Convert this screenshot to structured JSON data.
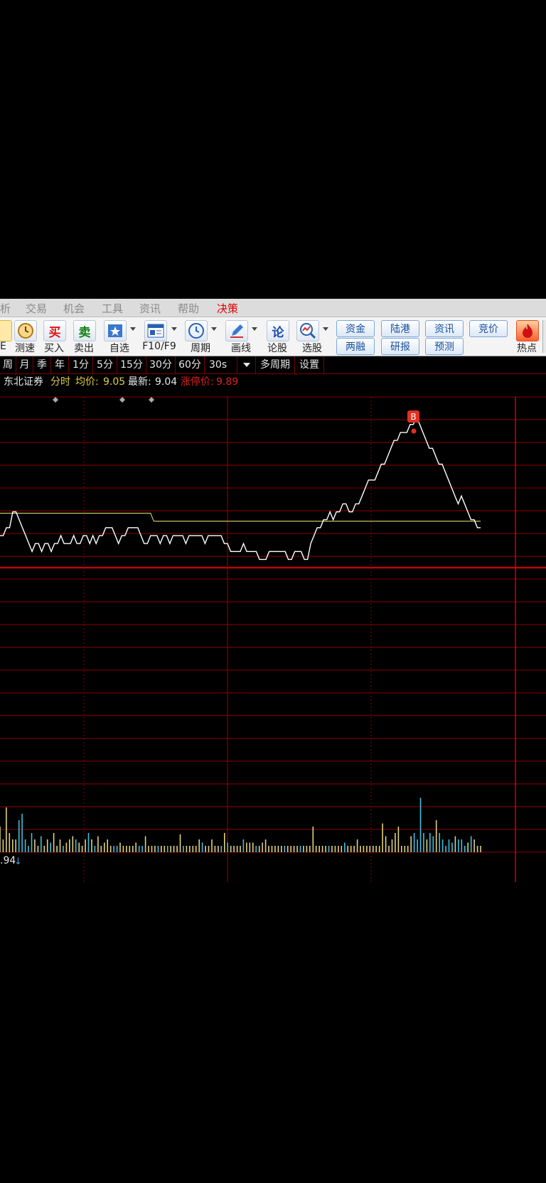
{
  "menu": {
    "items": [
      "析",
      "交易",
      "机会",
      "工具",
      "资讯",
      "帮助",
      "决策"
    ],
    "active": "决策"
  },
  "toolbar": {
    "buttons": [
      {
        "label": "E",
        "icon": "partial-icon"
      },
      {
        "label": "测速",
        "icon": "clock-icon"
      },
      {
        "label": "买入",
        "icon": "buy-icon",
        "glyph": "买"
      },
      {
        "label": "卖出",
        "icon": "sell-icon",
        "glyph": "卖"
      },
      {
        "label": "自选",
        "icon": "star-icon"
      },
      {
        "label": "F10/F9",
        "icon": "f10-icon"
      },
      {
        "label": "周期",
        "icon": "period-clock-icon"
      },
      {
        "label": "画线",
        "icon": "pencil-icon"
      },
      {
        "label": "论股",
        "icon": "discuss-icon",
        "glyph": "论"
      },
      {
        "label": "选股",
        "icon": "magnifier-chart-icon"
      },
      {
        "label": "热点",
        "icon": "hot-icon"
      }
    ],
    "pills": [
      "资金",
      "陆港",
      "资讯",
      "竞价",
      "两融",
      "研报",
      "预测"
    ]
  },
  "periods": [
    "周",
    "月",
    "季",
    "年",
    "1分",
    "5分",
    "15分",
    "30分",
    "60分",
    "30s",
    "多周期",
    "设置"
  ],
  "info": {
    "name": "东北证券",
    "mode": "分时",
    "avg_label": "均价:",
    "avg_value": "9.05",
    "last_label": "最新:",
    "last_value": "9.04",
    "limit_label": "涨停价:",
    "limit_value": "9.89"
  },
  "footer_value": ".94",
  "marker_label": "B",
  "colors": {
    "grid": "#8b0000",
    "price_line": "#ffffff",
    "avg_line": "#c8c060",
    "volume_up": "#e0d080",
    "volume_down": "#40c0e0",
    "marker": "#e03020",
    "limit_text": "#e02020",
    "avg_text": "#e0d040"
  },
  "chart_data": {
    "type": "line",
    "series": [
      {
        "name": "分时",
        "values": [
          9.03,
          9.03,
          9.04,
          9.04,
          9.06,
          9.06,
          9.05,
          9.04,
          9.03,
          9.02,
          9.01,
          9.02,
          9.02,
          9.01,
          9.02,
          9.02,
          9.01,
          9.02,
          9.02,
          9.03,
          9.02,
          9.02,
          9.02,
          9.03,
          9.02,
          9.02,
          9.03,
          9.03,
          9.02,
          9.03,
          9.02,
          9.03,
          9.03,
          9.04,
          9.04,
          9.04,
          9.03,
          9.02,
          9.03,
          9.03,
          9.04,
          9.04,
          9.04,
          9.04,
          9.03,
          9.02,
          9.02,
          9.03,
          9.03,
          9.03,
          9.02,
          9.03,
          9.03,
          9.02,
          9.03,
          9.03,
          9.03,
          9.03,
          9.02,
          9.03,
          9.03,
          9.03,
          9.03,
          9.03,
          9.02,
          9.03,
          9.03,
          9.03,
          9.03,
          9.03,
          9.02,
          9.02,
          9.01,
          9.01,
          9.01,
          9.01,
          9.02,
          9.01,
          9.01,
          9.01,
          9.01,
          9.0,
          9.0,
          9.0,
          9.01,
          9.01,
          9.01,
          9.01,
          9.01,
          9.01,
          9.0,
          9.0,
          9.01,
          9.01,
          9.01,
          9.0,
          9.0,
          9.02,
          9.03,
          9.04,
          9.04,
          9.05,
          9.05,
          9.06,
          9.05,
          9.06,
          9.06,
          9.07,
          9.07,
          9.06,
          9.06,
          9.07,
          9.07,
          9.08,
          9.09,
          9.1,
          9.1,
          9.1,
          9.11,
          9.12,
          9.12,
          9.13,
          9.14,
          9.15,
          9.15,
          9.16,
          9.16,
          9.16,
          9.17,
          9.17,
          9.18,
          9.17,
          9.16,
          9.15,
          9.14,
          9.14,
          9.13,
          9.12,
          9.12,
          9.11,
          9.1,
          9.09,
          9.08,
          9.07,
          9.08,
          9.07,
          9.06,
          9.05,
          9.05,
          9.04,
          9.04
        ]
      },
      {
        "name": "均价",
        "values": [
          9.06,
          9.06,
          9.06,
          9.06,
          9.06,
          9.06,
          9.06,
          9.06,
          9.06,
          9.06,
          9.06,
          9.06,
          9.06,
          9.06,
          9.06,
          9.06,
          9.06,
          9.06,
          9.06,
          9.06,
          9.06,
          9.06,
          9.06,
          9.06,
          9.06,
          9.06,
          9.06,
          9.06,
          9.06,
          9.06,
          9.06,
          9.06,
          9.06,
          9.06,
          9.06,
          9.06,
          9.06,
          9.06,
          9.06,
          9.06,
          9.06,
          9.06,
          9.06,
          9.06,
          9.06,
          9.06,
          9.06,
          9.06,
          9.05,
          9.05,
          9.05,
          9.05,
          9.05,
          9.05,
          9.05,
          9.05,
          9.05,
          9.05,
          9.05,
          9.05,
          9.05,
          9.05,
          9.05,
          9.05,
          9.05,
          9.05,
          9.05,
          9.05,
          9.05,
          9.05,
          9.05,
          9.05,
          9.05,
          9.05,
          9.05,
          9.05,
          9.05,
          9.05,
          9.05,
          9.05,
          9.05,
          9.05,
          9.05,
          9.05,
          9.05,
          9.05,
          9.05,
          9.05,
          9.05,
          9.05,
          9.05,
          9.05,
          9.05,
          9.05,
          9.05,
          9.05,
          9.05,
          9.05,
          9.05,
          9.05,
          9.05,
          9.05,
          9.05,
          9.05,
          9.05,
          9.05,
          9.05,
          9.05,
          9.05,
          9.05,
          9.05,
          9.05,
          9.05,
          9.05,
          9.05,
          9.05,
          9.05,
          9.05,
          9.05,
          9.05,
          9.05,
          9.05,
          9.05,
          9.05,
          9.05,
          9.05,
          9.05,
          9.05,
          9.05,
          9.05,
          9.05,
          9.05,
          9.05,
          9.05,
          9.05,
          9.05,
          9.05,
          9.05,
          9.05,
          9.05,
          9.05,
          9.05,
          9.05,
          9.05,
          9.05,
          9.05,
          9.05,
          9.05,
          9.05,
          9.05,
          9.05
        ]
      }
    ],
    "volume": [
      0.4,
      0.2,
      0.7,
      0.3,
      0.2,
      0.2,
      0.5,
      0.6,
      0.2,
      0.1,
      0.3,
      0.2,
      0.1,
      0.25,
      0.1,
      0.2,
      0.15,
      0.3,
      0.1,
      0.2,
      0.1,
      0.15,
      0.2,
      0.25,
      0.2,
      0.15,
      0.1,
      0.2,
      0.3,
      0.2,
      0.1,
      0.25,
      0.1,
      0.15,
      0.2,
      0.1,
      0.1,
      0.1,
      0.15,
      0.1,
      0.1,
      0.1,
      0.1,
      0.15,
      0.1,
      0.1,
      0.25,
      0.1,
      0.1,
      0.1,
      0.1,
      0.1,
      0.1,
      0.1,
      0.1,
      0.1,
      0.1,
      0.28,
      0.1,
      0.1,
      0.1,
      0.1,
      0.1,
      0.2,
      0.15,
      0.1,
      0.1,
      0.2,
      0.1,
      0.1,
      0.1,
      0.3,
      0.15,
      0.1,
      0.1,
      0.1,
      0.1,
      0.2,
      0.15,
      0.15,
      0.15,
      0.1,
      0.1,
      0.15,
      0.2,
      0.1,
      0.1,
      0.1,
      0.1,
      0.1,
      0.1,
      0.1,
      0.1,
      0.1,
      0.1,
      0.1,
      0.1,
      0.1,
      0.1,
      0.4,
      0.1,
      0.1,
      0.1,
      0.1,
      0.1,
      0.1,
      0.1,
      0.1,
      0.1,
      0.15,
      0.1,
      0.1,
      0.1,
      0.2,
      0.1,
      0.1,
      0.1,
      0.1,
      0.1,
      0.1,
      0.1,
      0.45,
      0.25,
      0.1,
      0.2,
      0.3,
      0.4,
      0.1,
      0.1,
      0.1,
      0.25,
      0.3,
      0.2,
      0.85,
      0.3,
      0.2,
      0.3,
      0.25,
      0.5,
      0.3,
      0.2,
      0.1,
      0.2,
      0.15,
      0.25,
      0.2,
      0.2,
      0.1,
      0.15,
      0.25,
      0.2,
      0.1,
      0.1
    ]
  }
}
